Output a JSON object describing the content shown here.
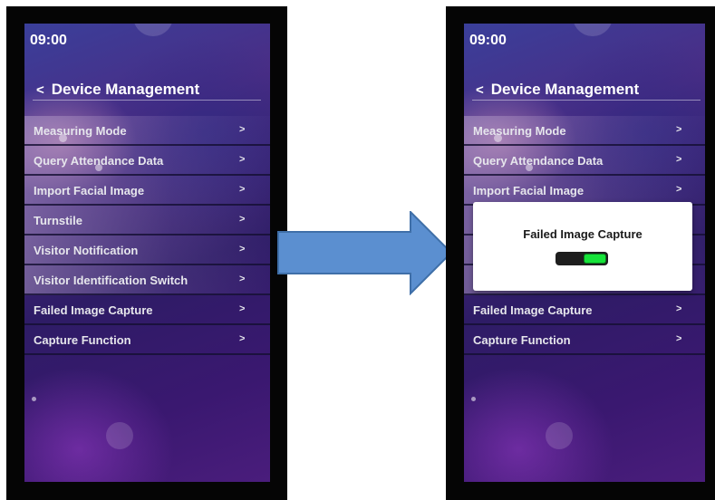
{
  "left_screen": {
    "time": "09:00",
    "back_symbol": "<",
    "title": "Device Management",
    "menu": [
      {
        "label": "Measuring Mode",
        "chevron": ">"
      },
      {
        "label": "Query Attendance Data",
        "chevron": ">"
      },
      {
        "label": "Import Facial Image",
        "chevron": ">"
      },
      {
        "label": "Turnstile",
        "chevron": ">"
      },
      {
        "label": "Visitor Notification",
        "chevron": ">"
      },
      {
        "label": "Visitor Identification Switch",
        "chevron": ">"
      },
      {
        "label": "Failed Image Capture",
        "chevron": ">"
      },
      {
        "label": "Capture Function",
        "chevron": ">"
      }
    ]
  },
  "right_screen": {
    "time": "09:00",
    "back_symbol": "<",
    "title": "Device Management",
    "menu": [
      {
        "label": "Measuring Mode",
        "chevron": ">"
      },
      {
        "label": "Query Attendance Data",
        "chevron": ">"
      },
      {
        "label": "Import Facial Image",
        "chevron": ">"
      },
      {
        "label": "",
        "chevron": ""
      },
      {
        "label": "",
        "chevron": ""
      },
      {
        "label": "",
        "chevron": ""
      },
      {
        "label": "Failed Image Capture",
        "chevron": ">"
      },
      {
        "label": "Capture Function",
        "chevron": ">"
      }
    ],
    "modal": {
      "title": "Failed Image Capture",
      "toggle_state": "on",
      "toggle_on_color": "#17e33a"
    }
  },
  "transition_arrow": {
    "icon": "right-arrow-icon",
    "color": "#5b8fd0"
  }
}
